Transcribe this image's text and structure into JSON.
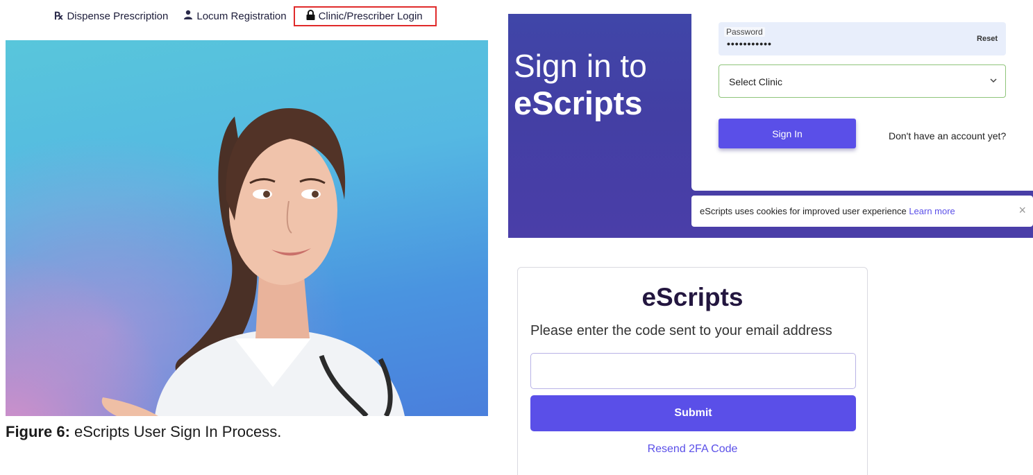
{
  "nav": {
    "items": [
      {
        "icon": "rx-icon",
        "glyph": "℞",
        "label": "Dispense Prescription"
      },
      {
        "icon": "user-icon",
        "glyph": "👤",
        "label": "Locum Registration"
      },
      {
        "icon": "lock-icon",
        "glyph": "🔒",
        "label": "Clinic/Prescriber Login"
      }
    ]
  },
  "caption": {
    "prefix": "Figure 6:",
    "text": " eScripts User Sign In Process."
  },
  "signin": {
    "heading_line1": "Sign in to",
    "heading_line2": "eScripts",
    "password_label": "Password",
    "password_value": "•••••••••••",
    "reset_label": "Reset",
    "clinic_selected": "Select Clinic",
    "signin_button": "Sign In",
    "no_account_link": "Don't have an account yet?",
    "cookie_text": "eScripts uses cookies for improved user experience ",
    "cookie_learn_more": "Learn more",
    "cookie_close": "×"
  },
  "twofa": {
    "title": "eScripts",
    "prompt": "Please enter the code sent to your email address",
    "code_value": "",
    "submit_button": "Submit",
    "resend_link": "Resend 2FA Code"
  },
  "colors": {
    "accent": "#5a4fe8",
    "panel": "#433fa4",
    "highlight_box": "#e02a2a"
  }
}
